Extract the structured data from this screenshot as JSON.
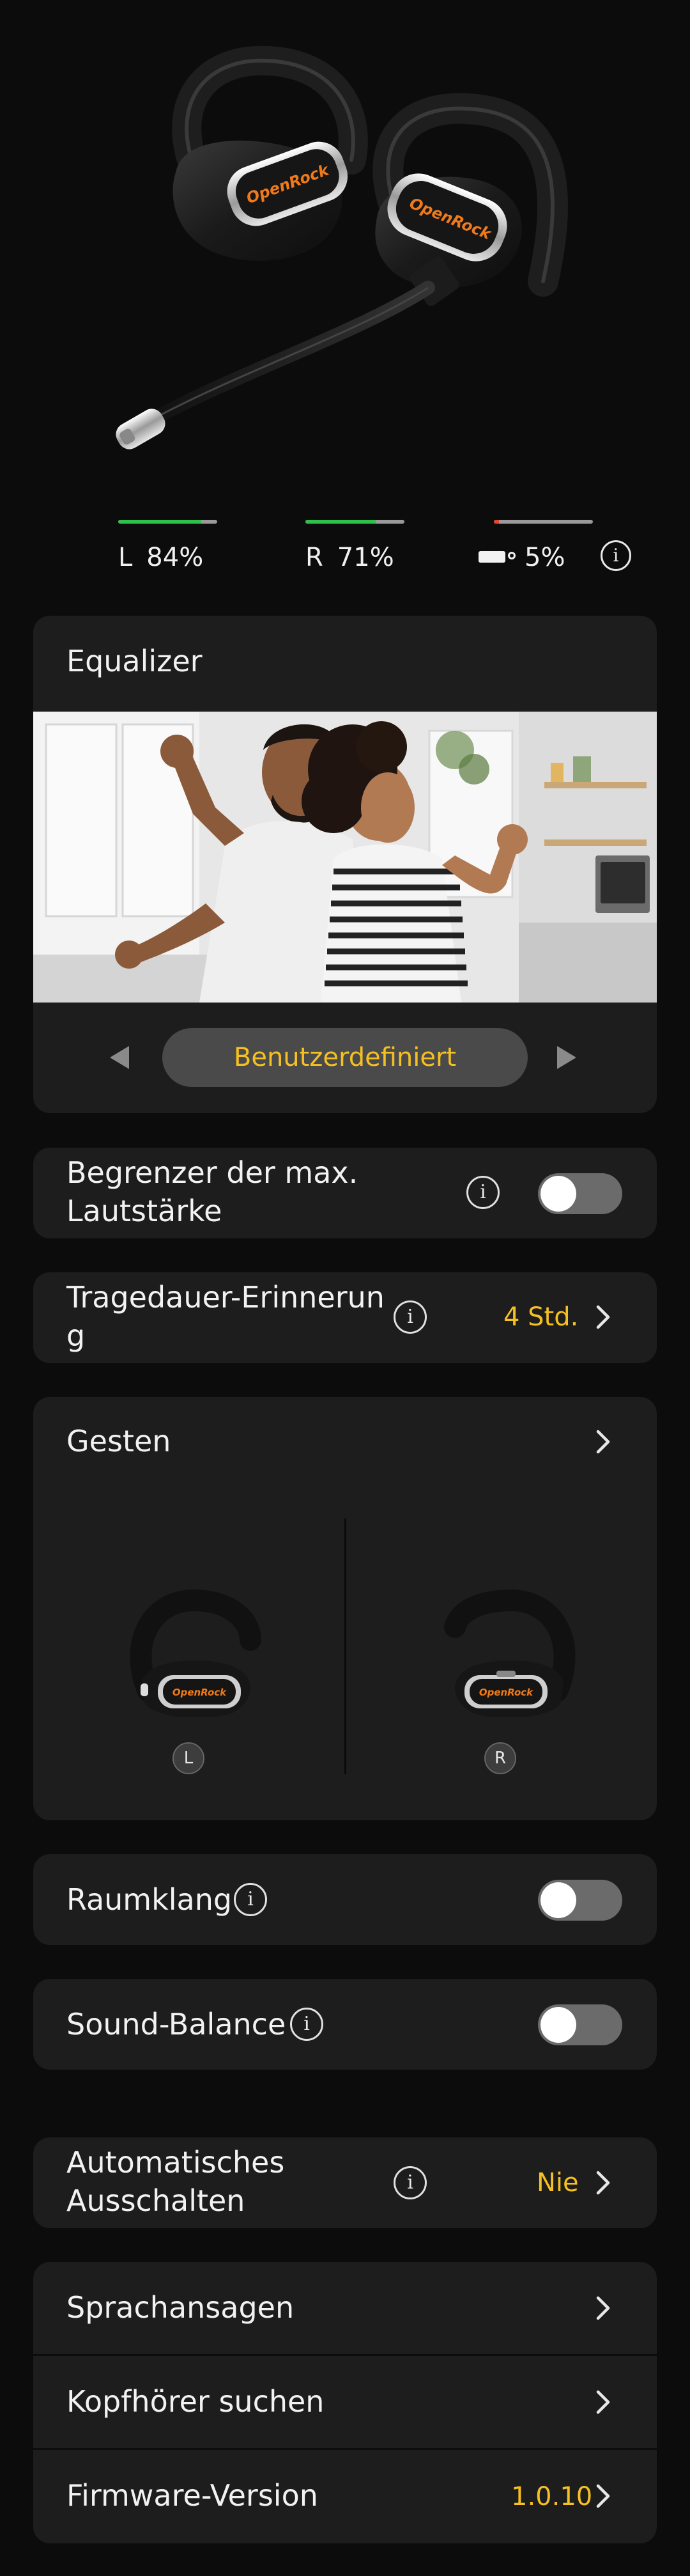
{
  "battery": {
    "left": {
      "side": "L",
      "percent": "84%",
      "level": 0.84
    },
    "right": {
      "side": "R",
      "percent": "71%",
      "level": 0.71
    },
    "case": {
      "percent": "5%",
      "level": 0.05
    },
    "info_glyph": "i"
  },
  "product": {
    "brand_left": "OpenRock",
    "brand_right": "OpenRock"
  },
  "equalizer": {
    "title": "Equalizer",
    "preset": "Benutzerdefiniert"
  },
  "volume_limiter": {
    "label_line1": "Begrenzer der max.",
    "label_line2": "Lautstärke",
    "enabled": false
  },
  "wear_reminder": {
    "label_line1": "Tragedauer-Erinnerun",
    "label_line2": "g",
    "value": "4 Std."
  },
  "gestures": {
    "title": "Gesten",
    "left_badge": "L",
    "right_badge": "R",
    "left_brand": "OpenRock",
    "right_brand": "OpenRock"
  },
  "spatial_audio": {
    "label": "Raumklang",
    "enabled": false
  },
  "sound_balance": {
    "label": "Sound-Balance",
    "enabled": false
  },
  "auto_off": {
    "label_line1": "Automatisches",
    "label_line2": "Ausschalten",
    "value": "Nie"
  },
  "menu": {
    "voice_prompts": "Sprachansagen",
    "find_earbuds": "Kopfhörer suchen",
    "firmware_label": "Firmware-Version",
    "firmware_value": "1.0.10"
  },
  "colors": {
    "accent_yellow": "#f5c021",
    "battery_green": "#2fbf4b",
    "battery_red": "#e0472d",
    "brand_orange": "#f07a1a",
    "card_bg": "#1d1d1d",
    "page_bg": "#0c0c0c"
  }
}
